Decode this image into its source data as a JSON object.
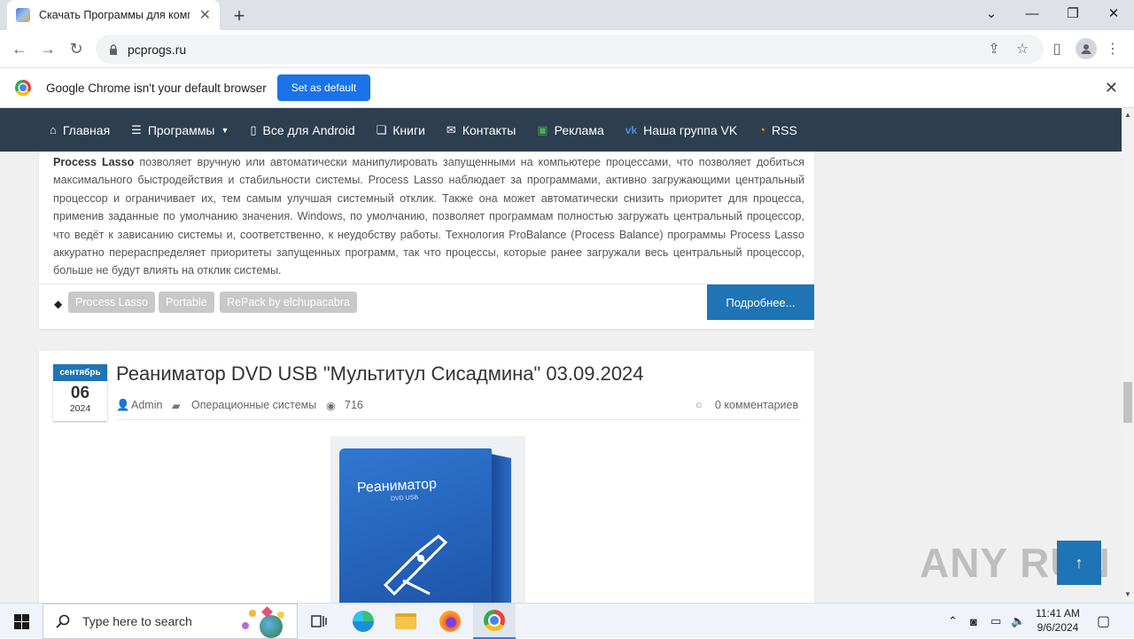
{
  "browser": {
    "tab_title": "Скачать Программы для комп",
    "url": "pcprogs.ru",
    "infobar_text": "Google Chrome isn't your default browser",
    "set_default_label": "Set as default"
  },
  "sitenav": {
    "items": [
      {
        "label": "Главная",
        "icon": "home-icon"
      },
      {
        "label": "Программы",
        "icon": "list-icon"
      },
      {
        "label": "Все для Android",
        "icon": "mobile-icon"
      },
      {
        "label": "Книги",
        "icon": "book-icon"
      },
      {
        "label": "Контакты",
        "icon": "envelope-icon"
      },
      {
        "label": "Реклама",
        "icon": "money-icon"
      },
      {
        "label": "Наша группа VK",
        "icon": "vk-icon"
      },
      {
        "label": "RSS",
        "icon": "rss-icon"
      }
    ]
  },
  "post1": {
    "lead": "Process Lasso",
    "text": "позволяет вручную или автоматически манипулировать запущенными на компьютере процессами, что позволяет добиться максимального быстродействия и стабильности системы. Process Lasso наблюдает за программами, активно загружающими центральный процессор и ограничивает их, тем самым улучшая системный отклик. Также она может автоматически снизить приоритет для процесса, применив заданные по умолчанию значения. Windows, по умолчанию, позволяет программам полностью загружать центральный процессор, что ведёт к зависанию системы и, соответственно, к неудобству работы. Технология ProBalance (Process Balance) программы Process Lasso аккуратно перераспределяет приоритеты запущенных программ, так что процессы, которые ранее загружали весь центральный процессор, больше не будут влиять на отклик системы.",
    "tags": [
      "Process Lasso",
      "Portable",
      "RePack by elchupacabra"
    ],
    "more_label": "Подробнее..."
  },
  "post2": {
    "month": "сентябрь",
    "day": "06",
    "year": "2024",
    "title": "Реаниматор DVD USB \"Мультитул Сисадмина\" 03.09.2024",
    "author": "Admin",
    "category": "Операционные системы",
    "views": "716",
    "comments": "0 комментариев",
    "box_title": "Реаниматор",
    "box_subtitle": "DVD USB"
  },
  "watermark": "ANY RUN",
  "taskbar": {
    "search_placeholder": "Type here to search",
    "time": "11:41 AM",
    "date": "9/6/2024"
  }
}
